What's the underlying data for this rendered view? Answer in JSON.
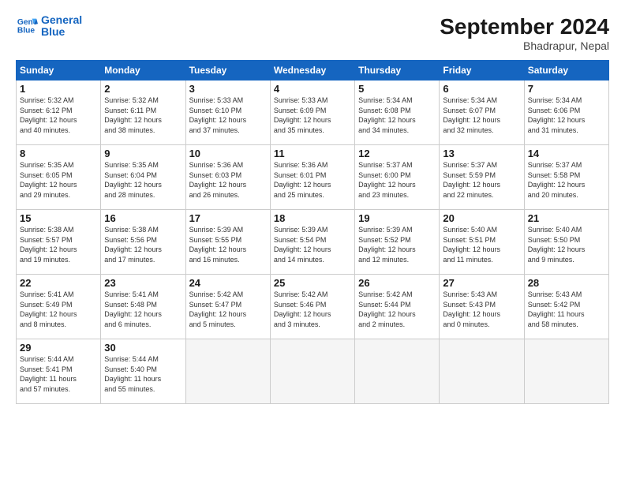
{
  "header": {
    "logo_line1": "General",
    "logo_line2": "Blue",
    "month": "September 2024",
    "location": "Bhadrapur, Nepal"
  },
  "weekdays": [
    "Sunday",
    "Monday",
    "Tuesday",
    "Wednesday",
    "Thursday",
    "Friday",
    "Saturday"
  ],
  "weeks": [
    [
      {
        "day": "1",
        "info": "Sunrise: 5:32 AM\nSunset: 6:12 PM\nDaylight: 12 hours\nand 40 minutes."
      },
      {
        "day": "2",
        "info": "Sunrise: 5:32 AM\nSunset: 6:11 PM\nDaylight: 12 hours\nand 38 minutes."
      },
      {
        "day": "3",
        "info": "Sunrise: 5:33 AM\nSunset: 6:10 PM\nDaylight: 12 hours\nand 37 minutes."
      },
      {
        "day": "4",
        "info": "Sunrise: 5:33 AM\nSunset: 6:09 PM\nDaylight: 12 hours\nand 35 minutes."
      },
      {
        "day": "5",
        "info": "Sunrise: 5:34 AM\nSunset: 6:08 PM\nDaylight: 12 hours\nand 34 minutes."
      },
      {
        "day": "6",
        "info": "Sunrise: 5:34 AM\nSunset: 6:07 PM\nDaylight: 12 hours\nand 32 minutes."
      },
      {
        "day": "7",
        "info": "Sunrise: 5:34 AM\nSunset: 6:06 PM\nDaylight: 12 hours\nand 31 minutes."
      }
    ],
    [
      {
        "day": "8",
        "info": "Sunrise: 5:35 AM\nSunset: 6:05 PM\nDaylight: 12 hours\nand 29 minutes."
      },
      {
        "day": "9",
        "info": "Sunrise: 5:35 AM\nSunset: 6:04 PM\nDaylight: 12 hours\nand 28 minutes."
      },
      {
        "day": "10",
        "info": "Sunrise: 5:36 AM\nSunset: 6:03 PM\nDaylight: 12 hours\nand 26 minutes."
      },
      {
        "day": "11",
        "info": "Sunrise: 5:36 AM\nSunset: 6:01 PM\nDaylight: 12 hours\nand 25 minutes."
      },
      {
        "day": "12",
        "info": "Sunrise: 5:37 AM\nSunset: 6:00 PM\nDaylight: 12 hours\nand 23 minutes."
      },
      {
        "day": "13",
        "info": "Sunrise: 5:37 AM\nSunset: 5:59 PM\nDaylight: 12 hours\nand 22 minutes."
      },
      {
        "day": "14",
        "info": "Sunrise: 5:37 AM\nSunset: 5:58 PM\nDaylight: 12 hours\nand 20 minutes."
      }
    ],
    [
      {
        "day": "15",
        "info": "Sunrise: 5:38 AM\nSunset: 5:57 PM\nDaylight: 12 hours\nand 19 minutes."
      },
      {
        "day": "16",
        "info": "Sunrise: 5:38 AM\nSunset: 5:56 PM\nDaylight: 12 hours\nand 17 minutes."
      },
      {
        "day": "17",
        "info": "Sunrise: 5:39 AM\nSunset: 5:55 PM\nDaylight: 12 hours\nand 16 minutes."
      },
      {
        "day": "18",
        "info": "Sunrise: 5:39 AM\nSunset: 5:54 PM\nDaylight: 12 hours\nand 14 minutes."
      },
      {
        "day": "19",
        "info": "Sunrise: 5:39 AM\nSunset: 5:52 PM\nDaylight: 12 hours\nand 12 minutes."
      },
      {
        "day": "20",
        "info": "Sunrise: 5:40 AM\nSunset: 5:51 PM\nDaylight: 12 hours\nand 11 minutes."
      },
      {
        "day": "21",
        "info": "Sunrise: 5:40 AM\nSunset: 5:50 PM\nDaylight: 12 hours\nand 9 minutes."
      }
    ],
    [
      {
        "day": "22",
        "info": "Sunrise: 5:41 AM\nSunset: 5:49 PM\nDaylight: 12 hours\nand 8 minutes."
      },
      {
        "day": "23",
        "info": "Sunrise: 5:41 AM\nSunset: 5:48 PM\nDaylight: 12 hours\nand 6 minutes."
      },
      {
        "day": "24",
        "info": "Sunrise: 5:42 AM\nSunset: 5:47 PM\nDaylight: 12 hours\nand 5 minutes."
      },
      {
        "day": "25",
        "info": "Sunrise: 5:42 AM\nSunset: 5:46 PM\nDaylight: 12 hours\nand 3 minutes."
      },
      {
        "day": "26",
        "info": "Sunrise: 5:42 AM\nSunset: 5:44 PM\nDaylight: 12 hours\nand 2 minutes."
      },
      {
        "day": "27",
        "info": "Sunrise: 5:43 AM\nSunset: 5:43 PM\nDaylight: 12 hours\nand 0 minutes."
      },
      {
        "day": "28",
        "info": "Sunrise: 5:43 AM\nSunset: 5:42 PM\nDaylight: 11 hours\nand 58 minutes."
      }
    ],
    [
      {
        "day": "29",
        "info": "Sunrise: 5:44 AM\nSunset: 5:41 PM\nDaylight: 11 hours\nand 57 minutes."
      },
      {
        "day": "30",
        "info": "Sunrise: 5:44 AM\nSunset: 5:40 PM\nDaylight: 11 hours\nand 55 minutes."
      },
      null,
      null,
      null,
      null,
      null
    ]
  ]
}
